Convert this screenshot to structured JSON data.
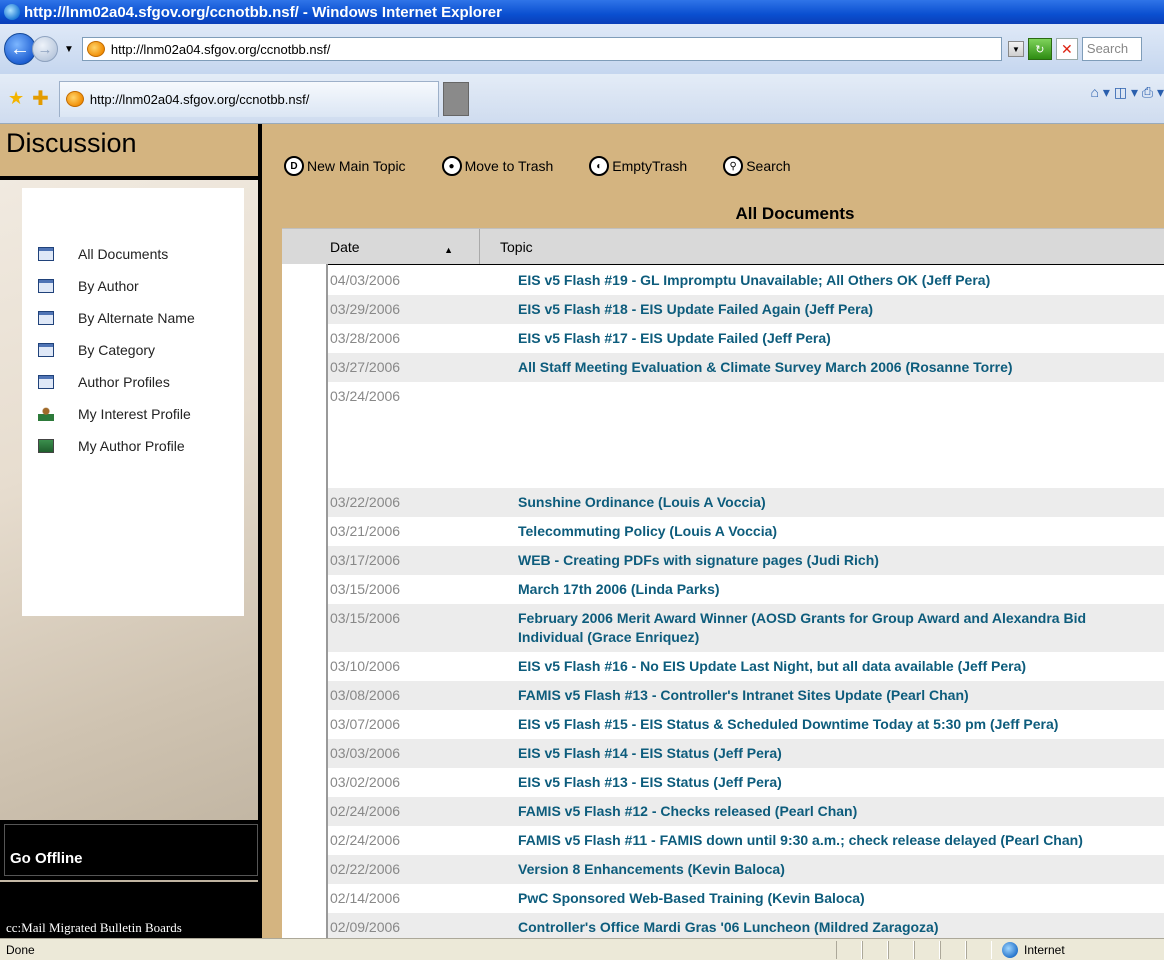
{
  "window": {
    "title": "http://lnm02a04.sfgov.org/ccnotbb.nsf/ - Windows Internet Explorer"
  },
  "address": {
    "url": "http://lnm02a04.sfgov.org/ccnotbb.nsf/",
    "search_placeholder": "Search"
  },
  "tab": {
    "label": "http://lnm02a04.sfgov.org/ccnotbb.nsf/"
  },
  "sidebar": {
    "title": "Discussion",
    "items": [
      {
        "label": "All Documents",
        "icon": "view-icon"
      },
      {
        "label": "By Author",
        "icon": "view-icon"
      },
      {
        "label": "By Alternate Name",
        "icon": "view-icon"
      },
      {
        "label": "By Category",
        "icon": "view-icon"
      },
      {
        "label": "Author Profiles",
        "icon": "view-icon"
      },
      {
        "label": "My Interest Profile",
        "icon": "interest-profile-icon"
      },
      {
        "label": "My Author Profile",
        "icon": "author-profile-icon"
      }
    ],
    "go_offline": "Go Offline",
    "footer": "cc:Mail Migrated Bulletin Boards"
  },
  "actions": {
    "new_main_topic": "New Main Topic",
    "move_to_trash": "Move to Trash",
    "empty_trash": "EmptyTrash",
    "search": "Search"
  },
  "view": {
    "title": "All Documents",
    "columns": {
      "date": "Date",
      "topic": "Topic"
    },
    "rows": [
      {
        "date": "04/03/2006",
        "topic": "EIS v5 Flash #19 - GL Impromptu Unavailable; All Others OK (Jeff Pera)"
      },
      {
        "date": "03/29/2006",
        "topic": "EIS v5 Flash #18 - EIS Update Failed Again (Jeff Pera)"
      },
      {
        "date": "03/28/2006",
        "topic": "EIS v5 Flash #17 - EIS Update Failed (Jeff Pera)"
      },
      {
        "date": "03/27/2006",
        "topic": "All Staff Meeting Evaluation & Climate Survey March 2006 (Rosanne Torre)"
      },
      {
        "date": "03/24/2006",
        "topic": ""
      },
      {
        "date": "03/22/2006",
        "topic": "Sunshine Ordinance (Louis A Voccia)"
      },
      {
        "date": "03/21/2006",
        "topic": "Telecommuting Policy (Louis A Voccia)"
      },
      {
        "date": "03/17/2006",
        "topic": "WEB - Creating PDFs with signature pages (Judi Rich)"
      },
      {
        "date": "03/15/2006",
        "topic": "March 17th 2006 (Linda Parks)"
      },
      {
        "date": "03/15/2006",
        "topic": "February 2006 Merit Award Winner (AOSD Grants for Group Award and Alexandra Bid",
        "topic2": "Individual (Grace Enriquez)"
      },
      {
        "date": "03/10/2006",
        "topic": "EIS v5 Flash #16 - No EIS Update Last Night, but all data available (Jeff Pera)"
      },
      {
        "date": "03/08/2006",
        "topic": "FAMIS v5 Flash #13 - Controller's Intranet Sites Update (Pearl Chan)"
      },
      {
        "date": "03/07/2006",
        "topic": "EIS v5 Flash #15 - EIS Status & Scheduled Downtime Today at 5:30 pm (Jeff Pera)"
      },
      {
        "date": "03/03/2006",
        "topic": "EIS v5 Flash #14 - EIS Status (Jeff Pera)"
      },
      {
        "date": "03/02/2006",
        "topic": "EIS v5 Flash #13 - EIS Status (Jeff Pera)"
      },
      {
        "date": "02/24/2006",
        "topic": "FAMIS v5 Flash #12 - Checks released (Pearl Chan)"
      },
      {
        "date": "02/24/2006",
        "topic": "FAMIS v5 Flash #11 - FAMIS down until 9:30 a.m.; check release delayed (Pearl Chan)"
      },
      {
        "date": "02/22/2006",
        "topic": "Version 8 Enhancements (Kevin Baloca)"
      },
      {
        "date": "02/14/2006",
        "topic": "PwC Sponsored Web-Based Training (Kevin Baloca)"
      },
      {
        "date": "02/09/2006",
        "topic": "Controller's Office Mardi Gras '06 Luncheon (Mildred Zaragoza)"
      }
    ]
  },
  "status": {
    "text": "Done",
    "zone": "Internet"
  },
  "colors": {
    "accent": "#d4b480",
    "link": "#0d5c7c",
    "titlebar": "#0a4fd0"
  }
}
